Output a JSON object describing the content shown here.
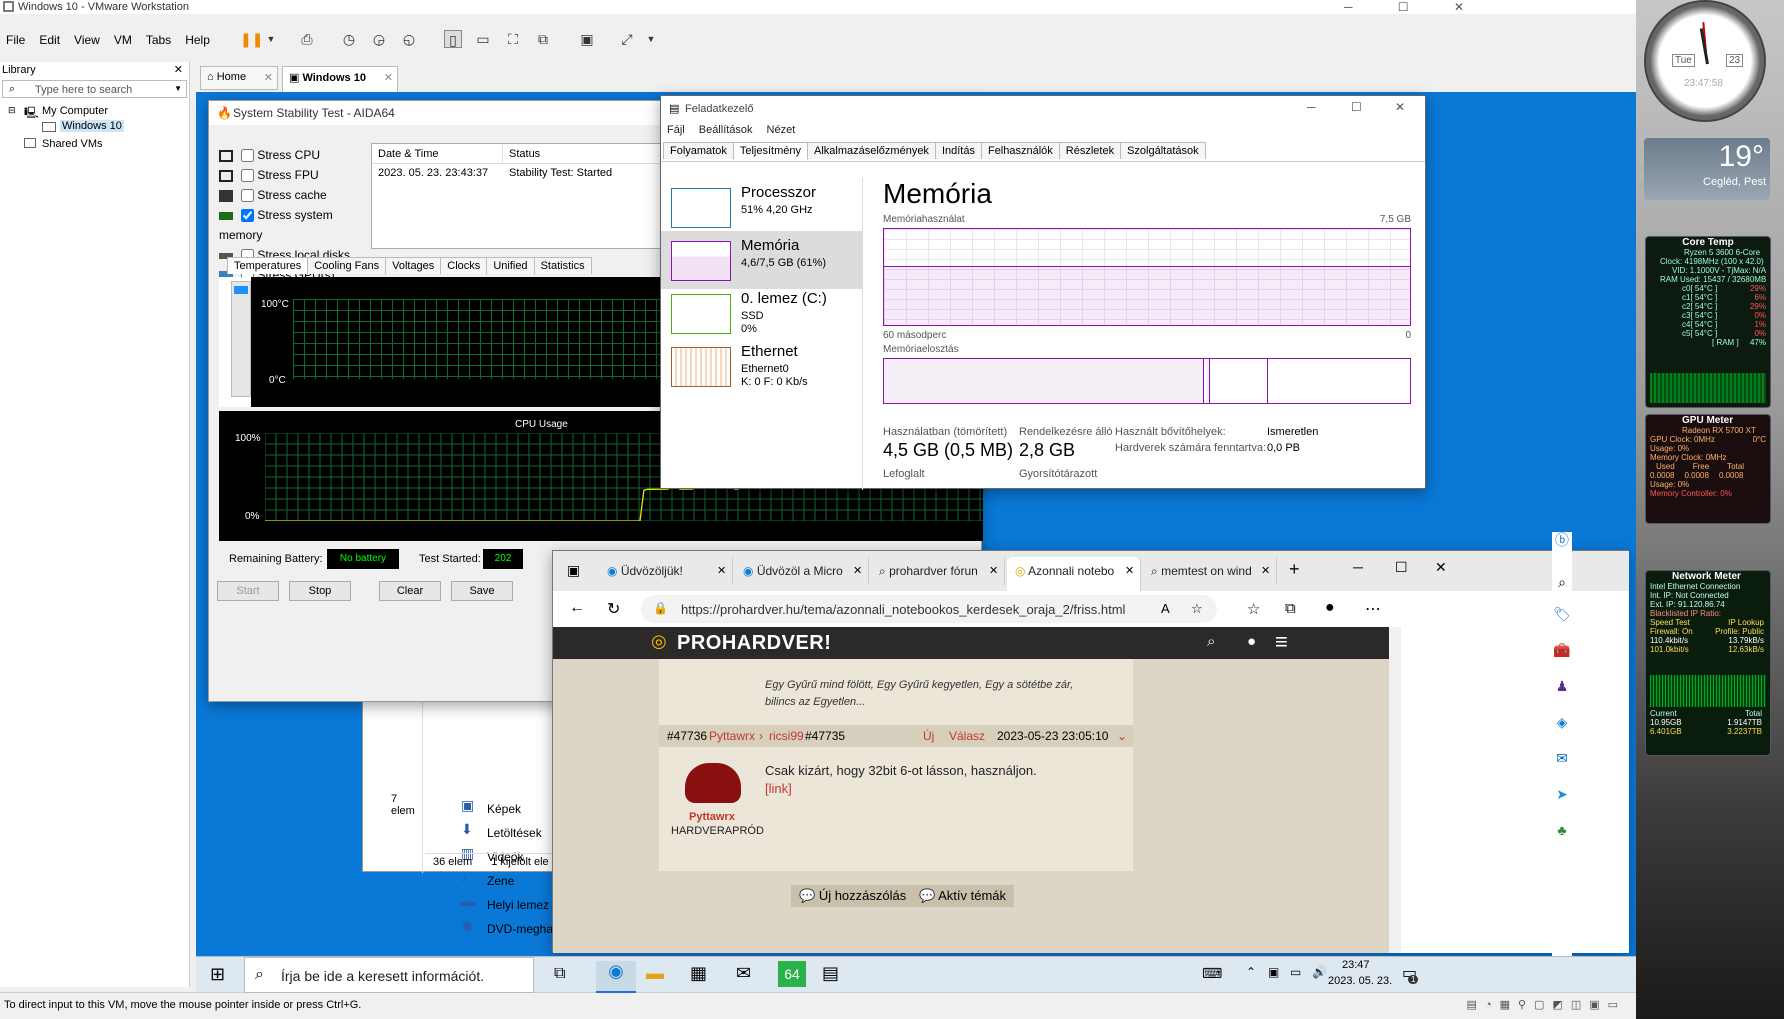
{
  "vmware": {
    "title": "Windows 10 - VMware Workstation",
    "menu": [
      "File",
      "Edit",
      "View",
      "VM",
      "Tabs",
      "Help"
    ],
    "library_title": "Library",
    "search_placeholder": "Type here to search",
    "tree": [
      "My Computer",
      "Windows 10",
      "Shared VMs"
    ],
    "tabs": [
      "Home",
      "Windows 10"
    ],
    "status": "To direct input to this VM, move the mouse pointer inside or press Ctrl+G."
  },
  "aida": {
    "title": "System Stability Test - AIDA64",
    "stress": [
      {
        "label": "Stress CPU",
        "checked": false
      },
      {
        "label": "Stress FPU",
        "checked": false
      },
      {
        "label": "Stress cache",
        "checked": false
      },
      {
        "label": "Stress system memory",
        "checked": true
      },
      {
        "label": "Stress local disks",
        "checked": false
      },
      {
        "label": "Stress GPU(s)",
        "checked": false
      }
    ],
    "col_date": "Date & Time",
    "col_status": "Status",
    "row_date": "2023. 05. 23. 23:43:37",
    "row_status": "Stability Test: Started",
    "tabs": [
      "Temperatures",
      "Cooling Fans",
      "Voltages",
      "Clocks",
      "Unified",
      "Statistics"
    ],
    "temp_top": "100°C",
    "temp_bottom": "0°C",
    "cpu_title": "CPU Usage",
    "cpu_top": "100%",
    "cpu_bottom": "0%",
    "battery_label": "Remaining Battery:",
    "battery_value": "No battery",
    "test_started_label": "Test Started:",
    "test_started_value": "202",
    "buttons": [
      "Start",
      "Stop",
      "Clear",
      "Save"
    ],
    "cpu_usage": [
      0,
      0,
      0,
      0,
      0,
      0,
      0,
      0,
      0,
      0,
      0,
      0,
      0,
      0,
      0,
      0,
      0,
      0,
      0,
      0,
      0,
      0,
      0,
      0,
      0,
      0,
      0,
      0,
      0,
      0,
      0,
      0,
      0,
      0,
      0,
      0,
      0,
      0,
      0,
      0,
      0,
      0,
      0,
      0,
      0,
      0,
      0,
      0,
      0,
      0,
      0,
      0,
      0,
      0,
      0,
      0,
      0,
      0,
      0,
      0,
      0,
      0,
      0,
      0,
      0,
      0,
      0,
      0,
      0,
      0,
      0,
      0,
      0,
      0,
      0,
      0,
      0,
      0,
      0,
      0,
      0,
      0,
      0,
      0,
      0,
      0,
      0,
      0,
      0,
      0,
      0,
      0,
      0,
      0,
      0,
      35,
      36,
      36,
      36,
      36,
      36,
      36,
      40,
      50,
      36,
      36,
      36,
      36,
      38,
      40,
      37,
      37,
      37,
      37,
      37,
      37,
      37,
      38,
      36,
      37,
      37,
      37,
      37,
      37,
      37,
      37,
      37,
      37,
      37,
      37,
      37,
      37,
      37,
      37,
      37,
      37,
      37,
      37,
      37,
      37,
      37,
      37,
      37,
      37,
      37,
      37,
      37,
      37,
      37,
      40,
      60,
      75,
      70,
      60,
      72,
      66,
      70,
      62,
      58,
      55,
      50,
      52,
      48,
      50,
      48,
      50,
      45,
      60,
      52,
      70,
      75,
      75,
      60,
      55,
      50,
      45,
      60,
      50,
      55,
      58,
      52
    ]
  },
  "taskmgr": {
    "title": "Feladatkezelő",
    "menu": [
      "Fájl",
      "Beállítások",
      "Nézet"
    ],
    "tabs": [
      "Folyamatok",
      "Teljesítmény",
      "Alkalmazáselőzmények",
      "Indítás",
      "Felhasználók",
      "Részletek",
      "Szolgáltatások"
    ],
    "side": [
      {
        "name": "Processzor",
        "line1": "51%  4,20 GHz",
        "line2": ""
      },
      {
        "name": "Memória",
        "line1": "4,6/7,5 GB (61%)",
        "line2": ""
      },
      {
        "name": "0. lemez (C:)",
        "line1": "SSD",
        "line2": "0%"
      },
      {
        "name": "Ethernet",
        "line1": "Ethernet0",
        "line2": "K: 0 F: 0 Kb/s"
      }
    ],
    "heading": "Memória",
    "usage_label": "Memóriahasználat",
    "usage_max": "7,5 GB",
    "axis_left": "60 másodperc",
    "axis_right": "0",
    "comp_label": "Memóriaelosztás",
    "in_use_label": "Használatban (tömörített)",
    "in_use_value": "4,5 GB (0,5 MB)",
    "avail_label": "Rendelkezésre álló",
    "avail_value": "2,8 GB",
    "slots_label": "Használt bővítőhelyek:",
    "slots_value": "Ismeretlen",
    "reserved_label": "Hardverek számára fenntartva:",
    "reserved_value": "0,0 PB",
    "committed_label": "Lefoglalt",
    "cached_label": "Gyorsítótárazott",
    "memory_usage_fraction": 0.61
  },
  "explorer": {
    "items": [
      "Képek",
      "Letöltések",
      "Videók",
      "Zene",
      "Helyi lemez (C:)",
      "DVD-meghajtó ("
    ],
    "count_left": "7 elem",
    "count": "36 elem",
    "selected": "1 kijelölt ele"
  },
  "edge": {
    "tabs": [
      "Üdvözöljük!",
      "Üdvözöl a Micro",
      "prohardver fórun",
      "Azonnali notebo",
      "memtest on wind"
    ],
    "url": "https://prohardver.hu/tema/azonnali_notebookos_kerdesek_oraja_2/friss.html",
    "brand": "PROHARDVER!",
    "quote": "Egy Gyűrű mind fölött, Egy Gyűrű kegyetlen, Egy a sötétbe zár, bilincs az Egyetlen...",
    "post_id": "#47736",
    "post_user": "Pyttawrx",
    "post_arrow": "›",
    "reply_to": "ricsi99",
    "reply_id": "#47735",
    "new_label": "Új",
    "reply_label": "Válasz",
    "post_time": "2023-05-23 23:05:10",
    "post_text": "Csak kizárt, hogy 32bit 6-ot lásson, használjon.",
    "link": "[link]",
    "author": "Pyttawrx",
    "author_rank": "HARDVERAPRÓD",
    "btn_new": "Új hozzászólás",
    "btn_active": "Aktív témák"
  },
  "taskbar": {
    "search": "Írja be ide a keresett információt.",
    "time": "23:47",
    "date": "2023. 05. 23.",
    "notif_count": "1"
  },
  "gadgets": {
    "clock_day": "Tue",
    "clock_date": "23",
    "clock_time": "23:47:58",
    "weather_temp": "19°",
    "weather_city": "Cegléd, Pest",
    "coretemp_title": "Core Temp",
    "coretemp_cpu": "Ryzen 5 3600 6-Core",
    "coretemp_clock": "Clock: 4198MHz (100 x 42.0)",
    "coretemp_vid": "VID: 1.1000V - TjMax: N/A",
    "coretemp_ram": "RAM Used: 15437 / 32680MB",
    "coretemp_ram_label": "[ RAM ]",
    "coretemp_ram_pct": "47%",
    "coretemp_cores": [
      {
        "t": "c0[ 54°C ]",
        "p": "29%"
      },
      {
        "t": "c1[ 54°C ]",
        "p": "6%"
      },
      {
        "t": "c2[ 54°C ]",
        "p": "29%"
      },
      {
        "t": "c3[ 54°C ]",
        "p": "0%"
      },
      {
        "t": "c4[ 54°C ]",
        "p": "1%"
      },
      {
        "t": "c5[ 54°C ]",
        "p": "0%"
      }
    ],
    "gpu_title": "GPU Meter",
    "gpu_name": "Radeon RX 5700 XT",
    "gpu_clock": "GPU Clock: 0MHz",
    "gpu_temp": "0°C",
    "gpu_usage": "Usage: 0%",
    "gpu_memclock": "Memory Clock: 0MHz",
    "gpu_used_label": "Used",
    "gpu_free_label": "Free",
    "gpu_total_label": "Total",
    "gpu_used": "0.0008",
    "gpu_free": "0.0008",
    "gpu_total": "0.0008",
    "gpu_usage2": "Usage: 0%",
    "gpu_memctrl": "Memory Controller: 0%",
    "net_title": "Network Meter",
    "net_lines": [
      "Intel Ethernet Connection",
      "Int. IP: Not Connected",
      "Ext. IP: 91.120.86.74",
      "Blacklisted IP Ratio:"
    ],
    "net_speed": "Speed Test",
    "net_lookup": "IP Lookup",
    "net_fw": "Firewall: On",
    "net_profile": "Profile: Public",
    "net_up1": "110.4kbit/s",
    "net_up2": "13.79kB/s",
    "net_dn1": "101.0kbit/s",
    "net_dn2": "12.63kB/s",
    "net_cur_label": "Current",
    "net_tot_label": "Total",
    "net_cur_up": "10.95GB",
    "net_tot_up": "1.9147TB",
    "net_cur_dn": "6.401GB",
    "net_tot_dn": "3.2237TB"
  },
  "colors": {
    "vm_bg": "#0a78d7",
    "aida_green": "#00ff00",
    "tm_purple": "#8b12ae",
    "ph_bar": "#2b2a28",
    "ph_red": "#c0392b"
  }
}
